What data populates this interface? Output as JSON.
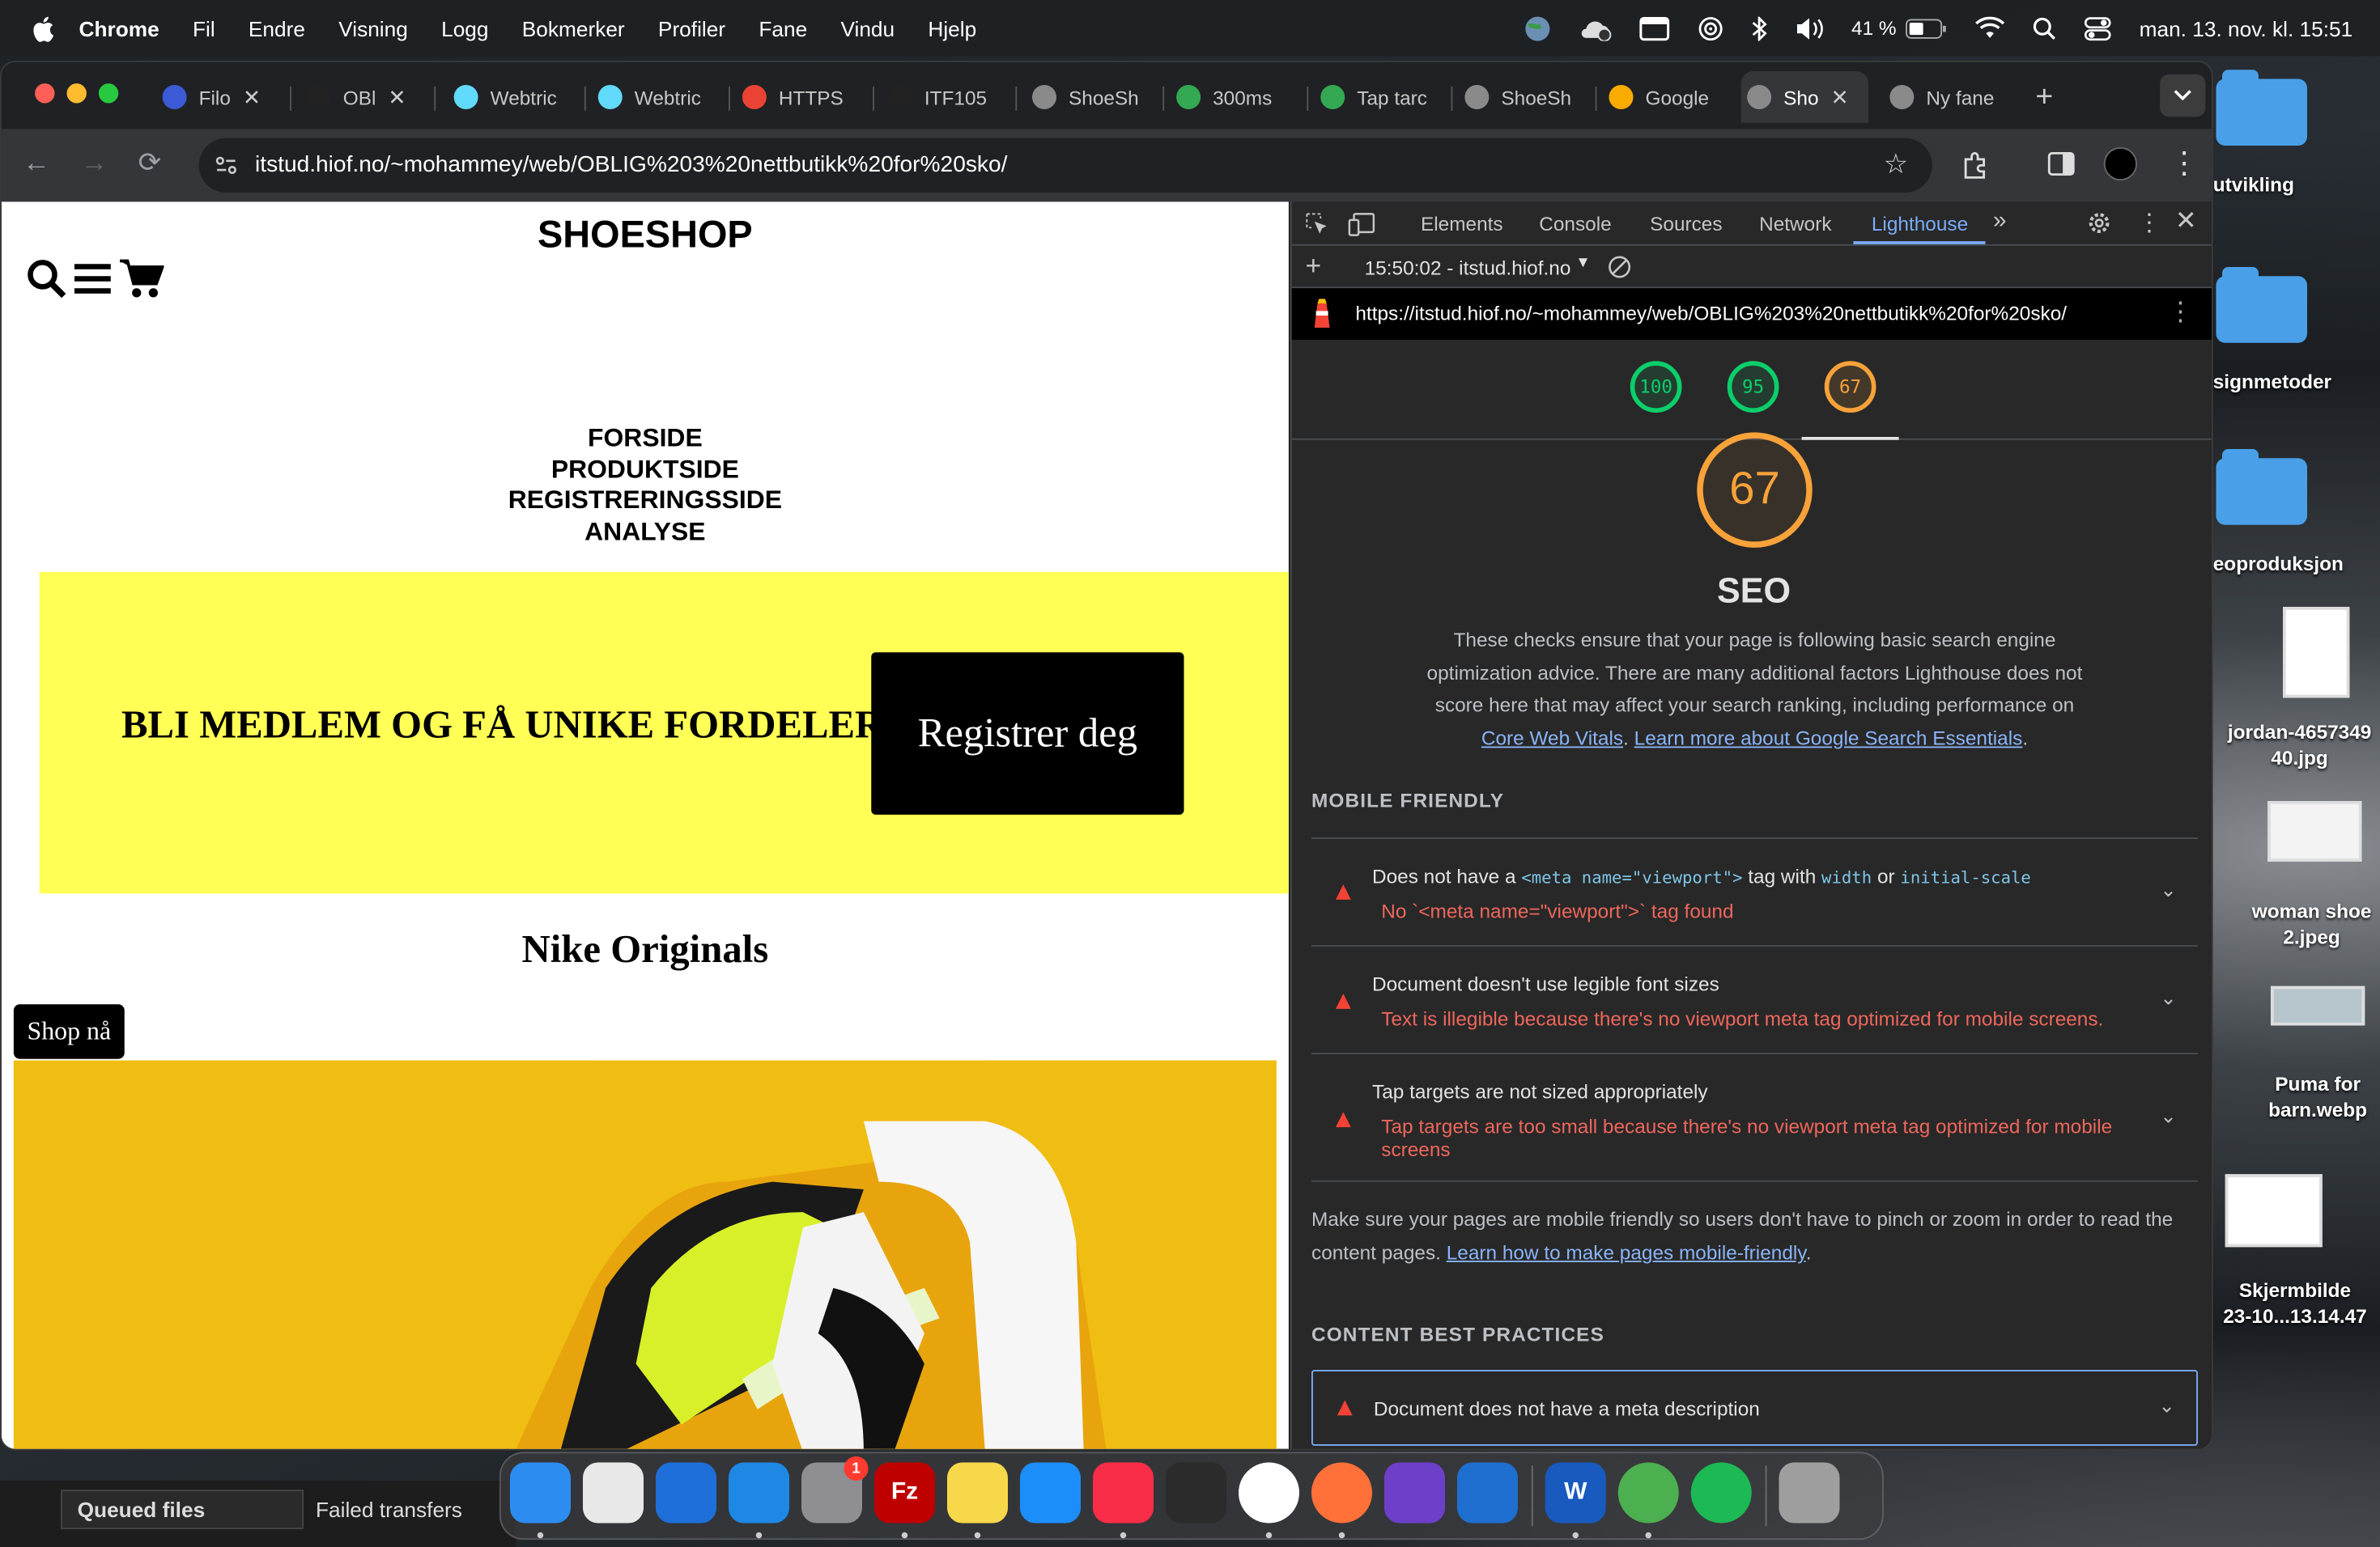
{
  "menubar": {
    "app": "Chrome",
    "items": [
      "Fil",
      "Endre",
      "Visning",
      "Logg",
      "Bokmerker",
      "Profiler",
      "Fane",
      "Vindu",
      "Hjelp"
    ],
    "battery": "41 %",
    "datetime": "man. 13. nov. kl. 15:51"
  },
  "desktop": {
    "items": [
      "utvikling",
      "signmetoder",
      "eoproduksjon",
      "jordan-4657349\n40.jpg",
      "woman shoe\n2.jpeg",
      "Puma for\nbarn.webp",
      "Skjermbilde\n23-10...13.14.47"
    ]
  },
  "tabs": [
    {
      "label": "Filo",
      "icon": "webflow",
      "color": "#3c5ad6"
    },
    {
      "label": "OBl",
      "icon": "circle-slash",
      "color": "#222"
    },
    {
      "label": "Webtric",
      "icon": "react",
      "color": "#61dafb"
    },
    {
      "label": "Webtric",
      "icon": "react",
      "color": "#61dafb"
    },
    {
      "label": "HTTPS",
      "icon": "google",
      "color": "#ea4335"
    },
    {
      "label": "ITF105",
      "icon": "circle-slash",
      "color": "#222"
    },
    {
      "label": "ShoeSh",
      "icon": "globe",
      "color": "#8a8a8a"
    },
    {
      "label": "300ms",
      "icon": "chrome",
      "color": "#34a853"
    },
    {
      "label": "Tap tarc",
      "icon": "chrome",
      "color": "#34a853"
    },
    {
      "label": "ShoeSh",
      "icon": "globe",
      "color": "#8a8a8a"
    },
    {
      "label": "Google",
      "icon": "chart",
      "color": "#f9ab00"
    },
    {
      "label": "Sho",
      "icon": "globe",
      "color": "#8a8a8a"
    },
    {
      "label": "Ny fane",
      "icon": "chrome",
      "color": "#8a8a8a"
    }
  ],
  "address": {
    "url": "itstud.hiof.no/~mohammey/web/OBLIG%203%20nettbutikk%20for%20sko/"
  },
  "page": {
    "logo": "SHOESHOP",
    "nav": [
      "FORSIDE",
      "PRODUKTSIDE",
      "REGISTRERINGSSIDE",
      "ANALYSE"
    ],
    "banner_text": "BLI MEDLEM OG FÅ UNIKE FORDELER",
    "register_button": "Registrer deg",
    "section_title": "Nike Originals",
    "shop_button": "Shop nå"
  },
  "devtools": {
    "tabs": [
      "Elements",
      "Console",
      "Sources",
      "Network",
      "Lighthouse"
    ],
    "active_tab": "Lighthouse",
    "report_label": "15:50:02 - itstud.hiof.no",
    "report_url": "https://itstud.hiof.no/~mohammey/web/OBLIG%203%20nettbutikk%20for%20sko/",
    "gauges": [
      {
        "score": 100,
        "color": "#0cce6b"
      },
      {
        "score": 95,
        "color": "#0cce6b"
      },
      {
        "score": 67,
        "color": "#f8a23a"
      }
    ],
    "seo": {
      "score": "67",
      "title": "SEO",
      "desc_1": "These checks ensure that your page is following basic search engine optimization advice. There are many additional factors Lighthouse does not score here that may affect your search ranking, including performance on",
      "link_1": "Core Web Vitals",
      "sep": ". ",
      "link_2": "Learn more about Google Search Essentials",
      "end": "."
    },
    "mobile_friendly": {
      "heading": "MOBILE FRIENDLY",
      "audits": [
        {
          "pre": "Does not have a ",
          "code_1": "<meta name=\"viewport\">",
          "mid": " tag with ",
          "code_2": "width",
          "or": " or ",
          "code_3": "initial-scale",
          "error": "No `<meta name=\"viewport\">` tag found"
        },
        {
          "title": "Document doesn't use legible font sizes",
          "error": "Text is illegible because there's no viewport meta tag optimized for mobile screens."
        },
        {
          "title": "Tap targets are not sized appropriately",
          "error": "Tap targets are too small because there's no viewport meta tag optimized for mobile screens"
        }
      ],
      "note": "Make sure your pages are mobile friendly so users don't have to pinch or zoom in order to read the content pages.",
      "note_link": "Learn how to make pages mobile-friendly",
      "note_end": "."
    },
    "content_best_practices": {
      "heading": "CONTENT BEST PRACTICES",
      "audit": "Document does not have a meta description"
    }
  },
  "filezilla": {
    "tabs": [
      "Queued files",
      "Failed transfers"
    ]
  },
  "dock": {
    "apps": [
      {
        "name": "Finder",
        "color": "#2d8cf0"
      },
      {
        "name": "Launchpad",
        "color": "#e8e8e8"
      },
      {
        "name": "OneDrive",
        "color": "#1e6fd9"
      },
      {
        "name": "Safari",
        "color": "#1e88e5"
      },
      {
        "name": "System Settings",
        "color": "#8e8e93",
        "badge": "1"
      },
      {
        "name": "FileZilla",
        "color": "#bf0000",
        "glyph": "Fz"
      },
      {
        "name": "Notes",
        "color": "#f7d84a"
      },
      {
        "name": "App Store",
        "color": "#1c8ef9"
      },
      {
        "name": "Music",
        "color": "#fa2d48"
      },
      {
        "name": "DaVinci Resolve",
        "color": "#2b2b2b"
      },
      {
        "name": "Chrome",
        "color": "#ffffff"
      },
      {
        "name": "Firefox",
        "color": "#ff7139"
      },
      {
        "name": "GitHub Desktop",
        "color": "#6e40c9"
      },
      {
        "name": "VS Code",
        "color": "#1f6fd0"
      },
      {
        "name": "Word",
        "color": "#185abd",
        "glyph": "W"
      },
      {
        "name": "Maps",
        "color": "#4caf50"
      },
      {
        "name": "Spotify",
        "color": "#1db954"
      },
      {
        "name": "Trash",
        "color": "#9e9e9e"
      }
    ]
  }
}
